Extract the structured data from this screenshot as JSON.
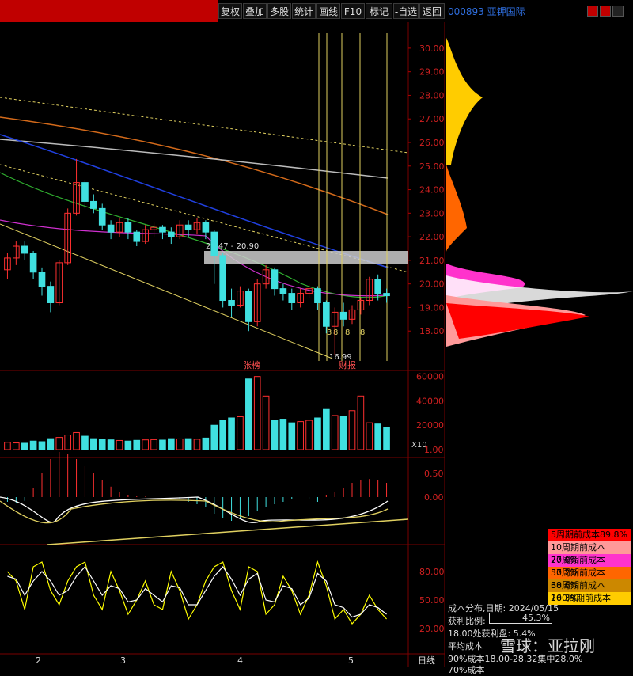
{
  "toolbar": {
    "buttons": [
      "复权",
      "叠加",
      "多股",
      "统计",
      "画线",
      "F10",
      "标记",
      "-自选",
      "返回"
    ]
  },
  "stock": {
    "code_name": "000893 亚钾国际"
  },
  "price_axis": {
    "ticks": [
      "30.00",
      "29.00",
      "28.00",
      "27.00",
      "26.00",
      "25.00",
      "24.00",
      "23.00",
      "22.00",
      "21.00",
      "20.00",
      "19.00",
      "18.00"
    ]
  },
  "volume_axis": {
    "ticks": [
      "60000",
      "40000",
      "20000"
    ],
    "unit": "X10"
  },
  "macd_axis": {
    "ticks": [
      "1.00",
      "0.50",
      "0.00"
    ]
  },
  "kdj_axis": {
    "ticks": [
      "80.00",
      "50.00",
      "20.00"
    ]
  },
  "x_axis": {
    "labels": [
      "2",
      "3",
      "4",
      "5"
    ],
    "period": "日线"
  },
  "annotations": {
    "range": "21.47 - 20.90",
    "low": "16.99",
    "event1": "张榜",
    "event2": "财报",
    "marks": [
      "3",
      "8",
      "8",
      "8"
    ]
  },
  "cost_legend": [
    {
      "label": "5周期前成本89.8%",
      "color": "#ff0000"
    },
    {
      "label": "10周期前成本77.0%",
      "color": "#ff9999"
    },
    {
      "label": "20周期前成本57.2%",
      "color": "#ff33cc"
    },
    {
      "label": "30周期前成本38.6%",
      "color": "#ff6600"
    },
    {
      "label": "60周期前成本26.3%",
      "color": "#cc8800"
    },
    {
      "label": "100周期前成本19.3%",
      "color": "#ffcc00"
    }
  ],
  "cost_info": {
    "date_line": "成本分布,日期: 2024/05/15",
    "profit_label": "获利比例:",
    "profit_value": "45.3%",
    "line3": "18.00处获利盘: 5.4%",
    "line4": "平均成本 ",
    "line5": "90%成本18.00-28.32集中28.0%",
    "line6": "70%成本"
  },
  "watermark": "雪球：亚拉刚",
  "chart_data": {
    "type": "candlestick",
    "price_range": [
      17.0,
      30.5
    ],
    "candles": [
      [
        20.6,
        21.1,
        20.2,
        21.3
      ],
      [
        21.1,
        21.6,
        20.8,
        21.8
      ],
      [
        21.6,
        21.3,
        21.0,
        21.8
      ],
      [
        21.3,
        20.5,
        20.2,
        21.4
      ],
      [
        20.5,
        19.9,
        19.5,
        20.7
      ],
      [
        19.9,
        19.2,
        18.8,
        20.1
      ],
      [
        19.2,
        20.9,
        19.1,
        21.0
      ],
      [
        20.9,
        23.0,
        20.8,
        23.2
      ],
      [
        23.0,
        24.3,
        22.9,
        25.3
      ],
      [
        24.3,
        23.5,
        23.2,
        24.4
      ],
      [
        23.5,
        23.2,
        23.0,
        23.8
      ],
      [
        23.2,
        22.5,
        22.3,
        23.4
      ],
      [
        22.5,
        22.2,
        21.9,
        22.7
      ],
      [
        22.2,
        22.6,
        22.0,
        22.8
      ],
      [
        22.6,
        22.2,
        21.9,
        22.8
      ],
      [
        22.2,
        21.8,
        21.6,
        22.3
      ],
      [
        21.8,
        22.3,
        21.7,
        22.5
      ],
      [
        22.3,
        22.4,
        22.0,
        22.6
      ],
      [
        22.4,
        22.2,
        21.9,
        22.5
      ],
      [
        22.2,
        22.0,
        21.7,
        22.4
      ],
      [
        22.0,
        22.5,
        21.9,
        22.7
      ],
      [
        22.5,
        22.3,
        22.0,
        22.7
      ],
      [
        22.3,
        22.6,
        22.1,
        22.8
      ],
      [
        22.6,
        22.2,
        21.9,
        22.7
      ],
      [
        22.2,
        21.2,
        20.0,
        22.3
      ],
      [
        21.2,
        19.3,
        19.0,
        21.3
      ],
      [
        19.3,
        19.1,
        18.6,
        19.8
      ],
      [
        19.1,
        19.7,
        19.0,
        19.9
      ],
      [
        19.7,
        18.4,
        18.0,
        19.8
      ],
      [
        18.4,
        20.0,
        18.2,
        20.2
      ],
      [
        20.0,
        20.6,
        19.8,
        20.8
      ],
      [
        20.6,
        19.8,
        19.5,
        20.7
      ],
      [
        19.8,
        19.6,
        19.3,
        20.0
      ],
      [
        19.6,
        19.2,
        18.9,
        19.8
      ],
      [
        19.2,
        19.6,
        19.0,
        19.8
      ],
      [
        19.6,
        19.8,
        19.4,
        20.0
      ],
      [
        19.8,
        19.2,
        18.9,
        19.9
      ],
      [
        19.2,
        18.2,
        17.9,
        19.3
      ],
      [
        18.2,
        18.8,
        17.0,
        19.0
      ],
      [
        18.8,
        18.5,
        18.2,
        19.2
      ],
      [
        18.5,
        18.9,
        18.3,
        19.1
      ],
      [
        18.9,
        19.3,
        18.7,
        19.4
      ],
      [
        19.3,
        20.2,
        19.1,
        20.3
      ],
      [
        20.2,
        19.6,
        19.3,
        20.4
      ],
      [
        19.6,
        19.5,
        19.2,
        19.8
      ]
    ],
    "volume": [
      6000,
      5500,
      5200,
      7000,
      6500,
      9000,
      10000,
      12000,
      14000,
      11000,
      9000,
      8500,
      8000,
      7500,
      7000,
      7600,
      8000,
      8200,
      7800,
      9000,
      8800,
      9000,
      8500,
      9500,
      20000,
      24000,
      26000,
      27000,
      58000,
      60000,
      44000,
      24000,
      25000,
      22000,
      23000,
      24000,
      26000,
      33000,
      28000,
      27000,
      32000,
      44000,
      22000,
      21000,
      18000
    ],
    "macd_hist": [
      -0.1,
      -0.12,
      -0.08,
      0.2,
      0.5,
      0.8,
      0.95,
      0.9,
      0.8,
      0.65,
      0.5,
      0.35,
      0.22,
      0.1,
      0.05,
      0.02,
      0.01,
      0.0,
      0.0,
      0.0,
      -0.05,
      -0.1,
      -0.15,
      -0.2,
      -0.35,
      -0.45,
      -0.5,
      -0.45,
      -0.4,
      -0.3,
      -0.2,
      -0.15,
      -0.1,
      -0.05,
      0.0,
      -0.05,
      -0.1,
      0.05,
      0.1,
      0.2,
      0.3,
      0.35,
      0.38,
      0.35,
      0.3
    ],
    "kdj_k": [
      80,
      70,
      40,
      85,
      90,
      60,
      45,
      70,
      85,
      90,
      55,
      40,
      80,
      60,
      35,
      50,
      70,
      45,
      40,
      80,
      60,
      30,
      45,
      70,
      85,
      90,
      60,
      40,
      85,
      80,
      35,
      45,
      75,
      60,
      35,
      55,
      90,
      65,
      30,
      40,
      25,
      35,
      55,
      40,
      30
    ],
    "kdj_d": [
      75,
      72,
      55,
      70,
      80,
      70,
      55,
      60,
      75,
      85,
      70,
      55,
      65,
      62,
      48,
      50,
      62,
      55,
      48,
      65,
      63,
      45,
      45,
      60,
      75,
      85,
      72,
      55,
      72,
      78,
      50,
      48,
      65,
      62,
      45,
      52,
      78,
      70,
      45,
      42,
      32,
      35,
      45,
      42,
      35
    ]
  }
}
